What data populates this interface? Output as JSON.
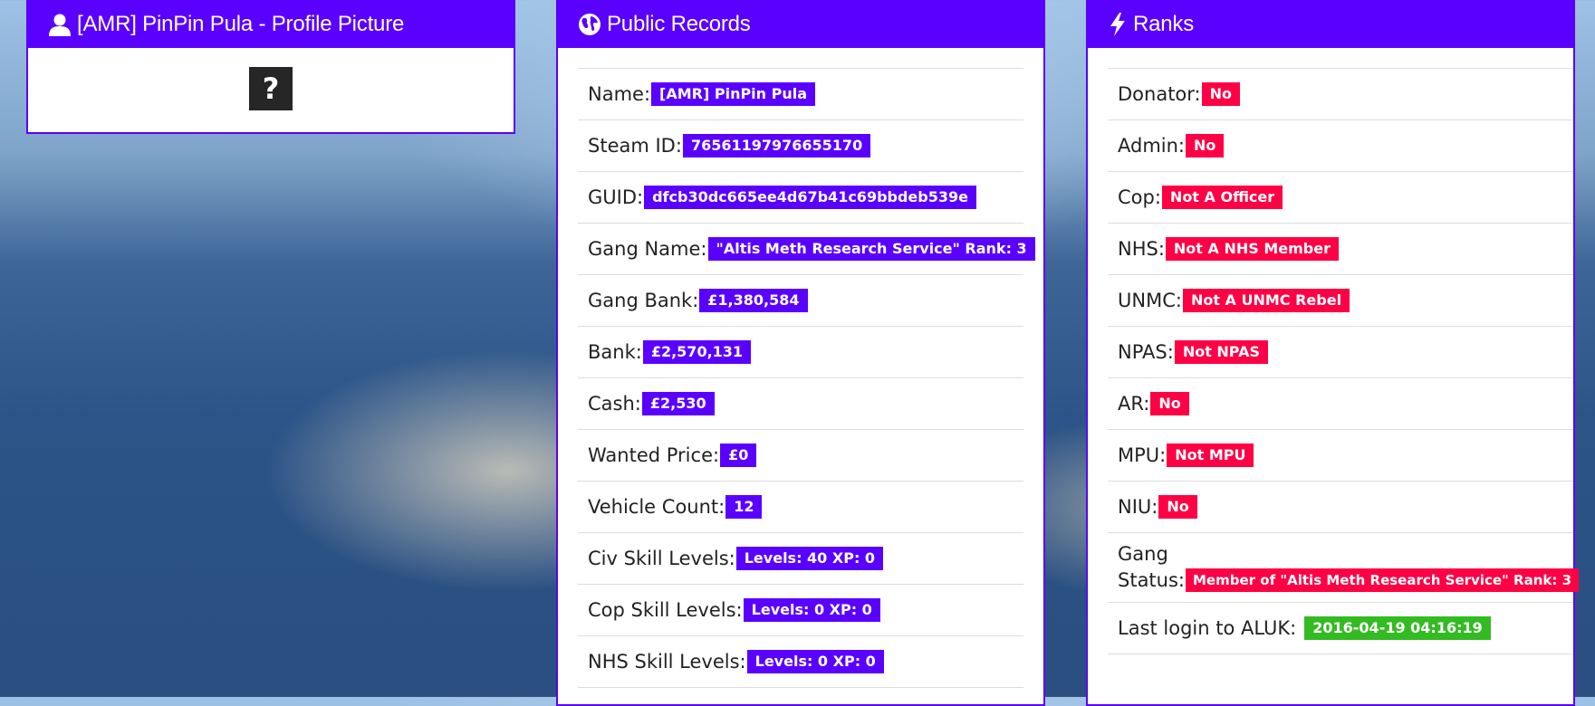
{
  "profile": {
    "title": "[AMR] PinPin Pula - Profile Picture",
    "placeholder_symbol": "?"
  },
  "records": {
    "title": "Public Records",
    "rows": [
      {
        "label": "Name:",
        "value": "[AMR] PinPin Pula"
      },
      {
        "label": "Steam ID:",
        "value": "76561197976655170"
      },
      {
        "label": "GUID:",
        "value": "dfcb30dc665ee4d67b41c69bbdeb539e"
      },
      {
        "label": "Gang Name:",
        "value": "\"Altis Meth Research Service\" Rank: 3"
      },
      {
        "label": "Gang Bank:",
        "value": "£1,380,584"
      },
      {
        "label": "Bank:",
        "value": "£2,570,131"
      },
      {
        "label": "Cash:",
        "value": "£2,530"
      },
      {
        "label": "Wanted Price:",
        "value": "£0"
      },
      {
        "label": "Vehicle Count:",
        "value": "12"
      },
      {
        "label": "Civ Skill Levels:",
        "value": "Levels: 40 XP: 0"
      },
      {
        "label": "Cop Skill Levels:",
        "value": "Levels: 0 XP: 0"
      },
      {
        "label": "NHS Skill Levels:",
        "value": "Levels: 0 XP: 0"
      }
    ]
  },
  "ranks": {
    "title": "Ranks",
    "rows": [
      {
        "label": "Donator:",
        "value": "No"
      },
      {
        "label": "Admin:",
        "value": "No"
      },
      {
        "label": "Cop:",
        "value": "Not A Officer"
      },
      {
        "label": "NHS:",
        "value": "Not A NHS Member"
      },
      {
        "label": "UNMC:",
        "value": "Not A UNMC Rebel"
      },
      {
        "label": "NPAS:",
        "value": "Not NPAS"
      },
      {
        "label": "AR:",
        "value": "No"
      },
      {
        "label": "MPU:",
        "value": "Not MPU"
      },
      {
        "label": "NIU:",
        "value": "No"
      },
      {
        "label_line1": "Gang",
        "label_line2": "Status:",
        "value": "Member of \"Altis Meth Research Service\" Rank: 3"
      },
      {
        "label": "Last login to ALUK:",
        "value": "2016-04-19 04:16:19"
      }
    ]
  },
  "colors": {
    "header": "#5a00ff",
    "badge_info": "#5a00ff",
    "badge_danger": "#ff0044",
    "badge_success": "#33bb22"
  }
}
